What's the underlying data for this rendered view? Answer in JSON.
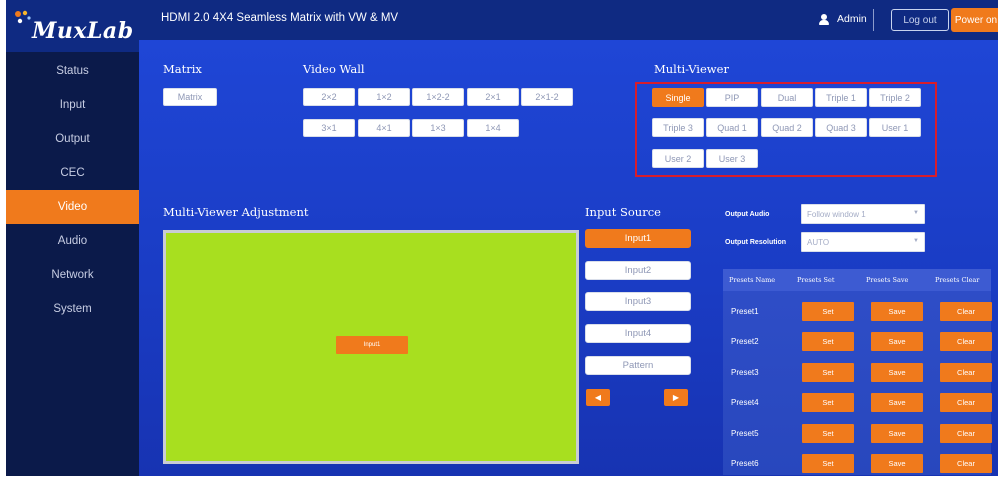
{
  "brand": "MuxLab",
  "header": {
    "title": "HDMI 2.0 4X4 Seamless Matrix with VW & MV",
    "user": "Admin",
    "logout_label": "Log out",
    "power_label": "Power on"
  },
  "sidebar": {
    "items": [
      {
        "label": "Status"
      },
      {
        "label": "Input"
      },
      {
        "label": "Output"
      },
      {
        "label": "CEC"
      },
      {
        "label": "Video",
        "active": true
      },
      {
        "label": "Audio"
      },
      {
        "label": "Network"
      },
      {
        "label": "System"
      }
    ]
  },
  "matrix": {
    "label": "Matrix",
    "button": "Matrix"
  },
  "video_wall": {
    "label": "Video Wall",
    "buttons": [
      "2×2",
      "1×2",
      "1×2-2",
      "2×1",
      "2×1-2",
      "3×1",
      "4×1",
      "1×3",
      "1×4"
    ]
  },
  "multi_viewer": {
    "label": "Multi-Viewer",
    "selected": "Single",
    "buttons": [
      "Single",
      "PIP",
      "Dual",
      "Triple 1",
      "Triple 2",
      "Triple 3",
      "Quad 1",
      "Quad 2",
      "Quad 3",
      "User 1",
      "User 2",
      "User 3"
    ]
  },
  "adjustment": {
    "label": "Multi-Viewer Adjustment",
    "window_label": "Input1"
  },
  "input_source": {
    "label": "Input Source",
    "selected": "Input1",
    "buttons": [
      "Input1",
      "Input2",
      "Input3",
      "Input4",
      "Pattern"
    ],
    "prev_glyph": "◀",
    "next_glyph": "▶"
  },
  "output": {
    "audio_label": "Output Audio",
    "audio_value": "Follow window 1",
    "resolution_label": "Output Resolution",
    "resolution_value": "AUTO"
  },
  "presets": {
    "columns": [
      "Presets Name",
      "Presets Set",
      "Presets Save",
      "Presets Clear"
    ],
    "set_label": "Set",
    "save_label": "Save",
    "clear_label": "Clear",
    "rows": [
      "Preset1",
      "Preset2",
      "Preset3",
      "Preset4",
      "Preset5",
      "Preset6"
    ]
  },
  "colors": {
    "accent": "#f07a1c",
    "header": "#0f2a82",
    "sidebar": "#0b1a4a",
    "main_bg": "#1f46d6",
    "highlight_box": "#d71d2c",
    "canvas": "#a8df1f"
  }
}
